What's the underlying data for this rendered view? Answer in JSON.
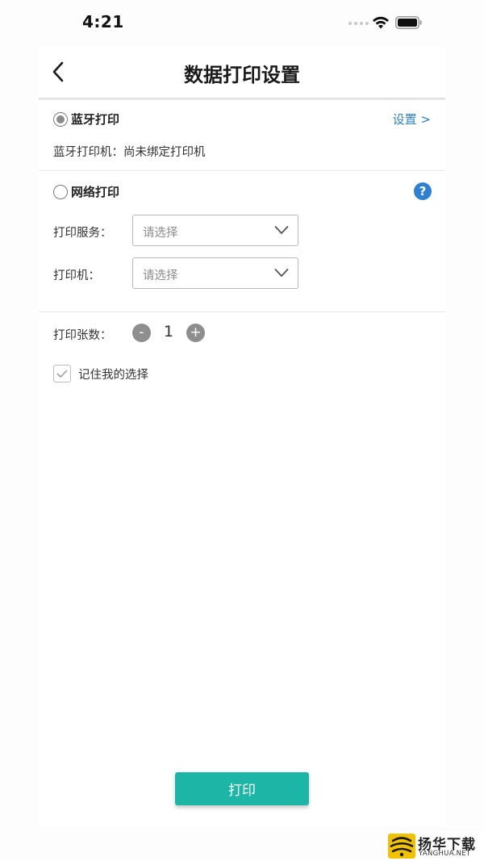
{
  "status_bar": {
    "time": "4:21"
  },
  "nav": {
    "title": "数据打印设置"
  },
  "bluetooth": {
    "option_label": "蓝牙打印",
    "selected": true,
    "settings_link": "设置 >",
    "printer_status": "蓝牙打印机：尚未绑定打印机"
  },
  "network": {
    "option_label": "网络打印",
    "selected": false,
    "help_symbol": "?",
    "service_label": "打印服务：",
    "service_placeholder": "请选择",
    "printer_label": "打印机：",
    "printer_placeholder": "请选择"
  },
  "copies": {
    "label": "打印张数：",
    "minus": "-",
    "value": "1",
    "plus": "+"
  },
  "remember": {
    "label": "记住我的选择",
    "checked": true
  },
  "actions": {
    "print_label": "打印"
  },
  "watermark": {
    "name": "扬华下载",
    "site": "YANGHUA.NET"
  },
  "colors": {
    "accent": "#1db5a5",
    "link": "#2f7fc9",
    "help": "#2f7fd2",
    "watermark_yellow": "#f2c200"
  },
  "icons": {
    "back": "chevron-left-icon",
    "wifi": "wifi-icon",
    "battery": "battery-icon",
    "help": "question-circle-icon",
    "dropdown": "chevron-down-icon",
    "check": "check-icon"
  }
}
